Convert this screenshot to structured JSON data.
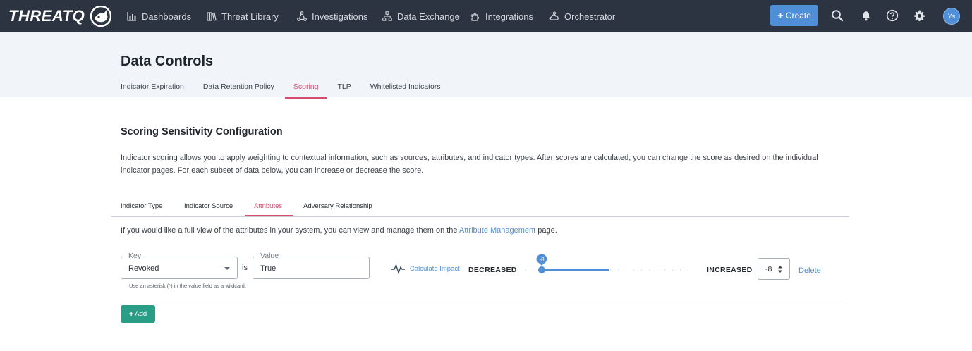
{
  "app": {
    "logo_text": "THREATQ",
    "nav_items": [
      {
        "label": "Dashboards",
        "icon": "bar-chart-icon"
      },
      {
        "label": "Threat Library",
        "icon": "books-icon"
      },
      {
        "label": "Investigations",
        "icon": "network-icon"
      },
      {
        "label": "Data Exchange",
        "icon": "sitemap-icon"
      },
      {
        "label": "Integrations",
        "icon": "puzzle-icon"
      },
      {
        "label": "Orchestrator",
        "icon": "cloud-gear-icon"
      }
    ],
    "create_label": "Create",
    "avatar_initials": "Ys",
    "accent_color": "#4f8fd8",
    "navbar_color": "#2c3441"
  },
  "page": {
    "title": "Data Controls",
    "subtabs": [
      {
        "label": "Indicator Expiration",
        "active": false
      },
      {
        "label": "Data Retention Policy",
        "active": false
      },
      {
        "label": "Scoring",
        "active": true
      },
      {
        "label": "TLP",
        "active": false
      },
      {
        "label": "Whitelisted Indicators",
        "active": false
      }
    ],
    "active_tab_color": "#d74b6e"
  },
  "scoring": {
    "section_title": "Scoring Sensitivity Configuration",
    "description": "Indicator scoring allows you to apply weighting to contextual information, such as sources, attributes, and indicator types. After scores are calculated, you can change the score as desired on the individual indicator pages. For each subset of data below, you can increase or decrease the score.",
    "tabs": [
      {
        "label": "Indicator Type",
        "active": false
      },
      {
        "label": "Indicator Source",
        "active": false
      },
      {
        "label": "Attributes",
        "active": true
      },
      {
        "label": "Adversary Relationship",
        "active": false
      }
    ],
    "note_prefix": "If you would like a full view of the attributes in your system, you can view and manage them on the ",
    "note_link": "Attribute Management",
    "note_suffix": " page.",
    "rule": {
      "key_legend": "Key",
      "key_value": "Revoked",
      "is_label": "is",
      "value_legend": "Value",
      "value_value": "True",
      "hint": "Use an asterisk (*) in the value field as a wildcard.",
      "calc_impact": "Calculate Impact",
      "decreased_label": "DECREASED",
      "increased_label": "INCREASED",
      "slider_value": "-8",
      "slider_min": -10,
      "slider_max": 10,
      "stepper_value": "-8",
      "delete_label": "Delete"
    },
    "add_label": "Add",
    "add_color": "#2a9d86"
  }
}
